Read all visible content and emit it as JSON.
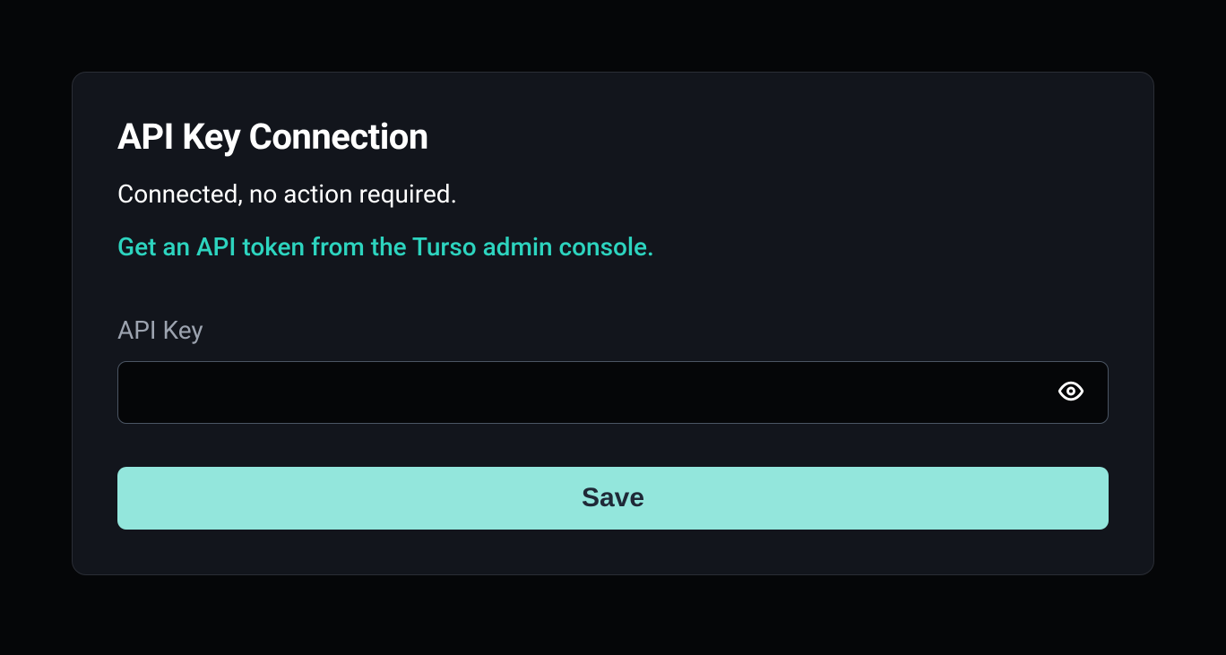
{
  "card": {
    "title": "API Key Connection",
    "status": "Connected, no action required.",
    "help_link": "Get an API token from the Turso admin console.",
    "field_label": "API Key",
    "input_value": "",
    "save_label": "Save"
  },
  "colors": {
    "accent": "#2dd4bf",
    "button_bg": "#93e6dc"
  }
}
